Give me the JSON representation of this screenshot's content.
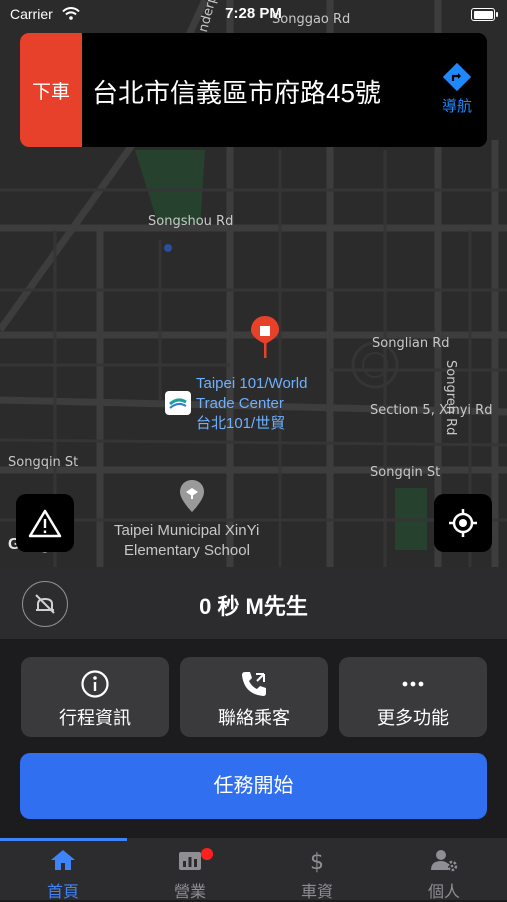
{
  "status_bar": {
    "carrier": "Carrier",
    "time": "7:28 PM"
  },
  "map": {
    "streets": [
      "Songgao Rd",
      "Songshou Rd",
      "Songlian Rd",
      "Section 5, Xinyi Rd",
      "Songqin St",
      "Songqin St",
      "Songren Rd",
      "nderp"
    ],
    "poi_taipei101": [
      "Taipei 101/World",
      "Trade Center",
      "台北101/世貿"
    ],
    "poi_school": [
      "Taipei Municipal XinYi",
      "Elementary School"
    ],
    "google_logo": "Google",
    "colors": {
      "road": "#3d3d3d",
      "park": "#27412f",
      "pin": "#e8412b",
      "poi_text": "#6fb0ff"
    }
  },
  "destination_banner": {
    "tag": "下車",
    "address": "台北市信義區市府路45號",
    "nav_label": "導航",
    "colors": {
      "tag": "#e8412b",
      "nav": "#1e88ff"
    }
  },
  "trip_status": {
    "text": "0 秒 M先生"
  },
  "actions": [
    {
      "label": "行程資訊",
      "icon": "info-icon"
    },
    {
      "label": "聯絡乘客",
      "icon": "phone-icon"
    },
    {
      "label": "更多功能",
      "icon": "more-icon"
    }
  ],
  "start_button": {
    "label": "任務開始",
    "color": "#2f6ff0"
  },
  "tabs": [
    {
      "label": "首頁",
      "icon": "home-icon",
      "active": true
    },
    {
      "label": "營業",
      "icon": "chart-icon",
      "badge": true
    },
    {
      "label": "車資",
      "icon": "dollar-icon"
    },
    {
      "label": "個人",
      "icon": "person-settings-icon"
    }
  ]
}
